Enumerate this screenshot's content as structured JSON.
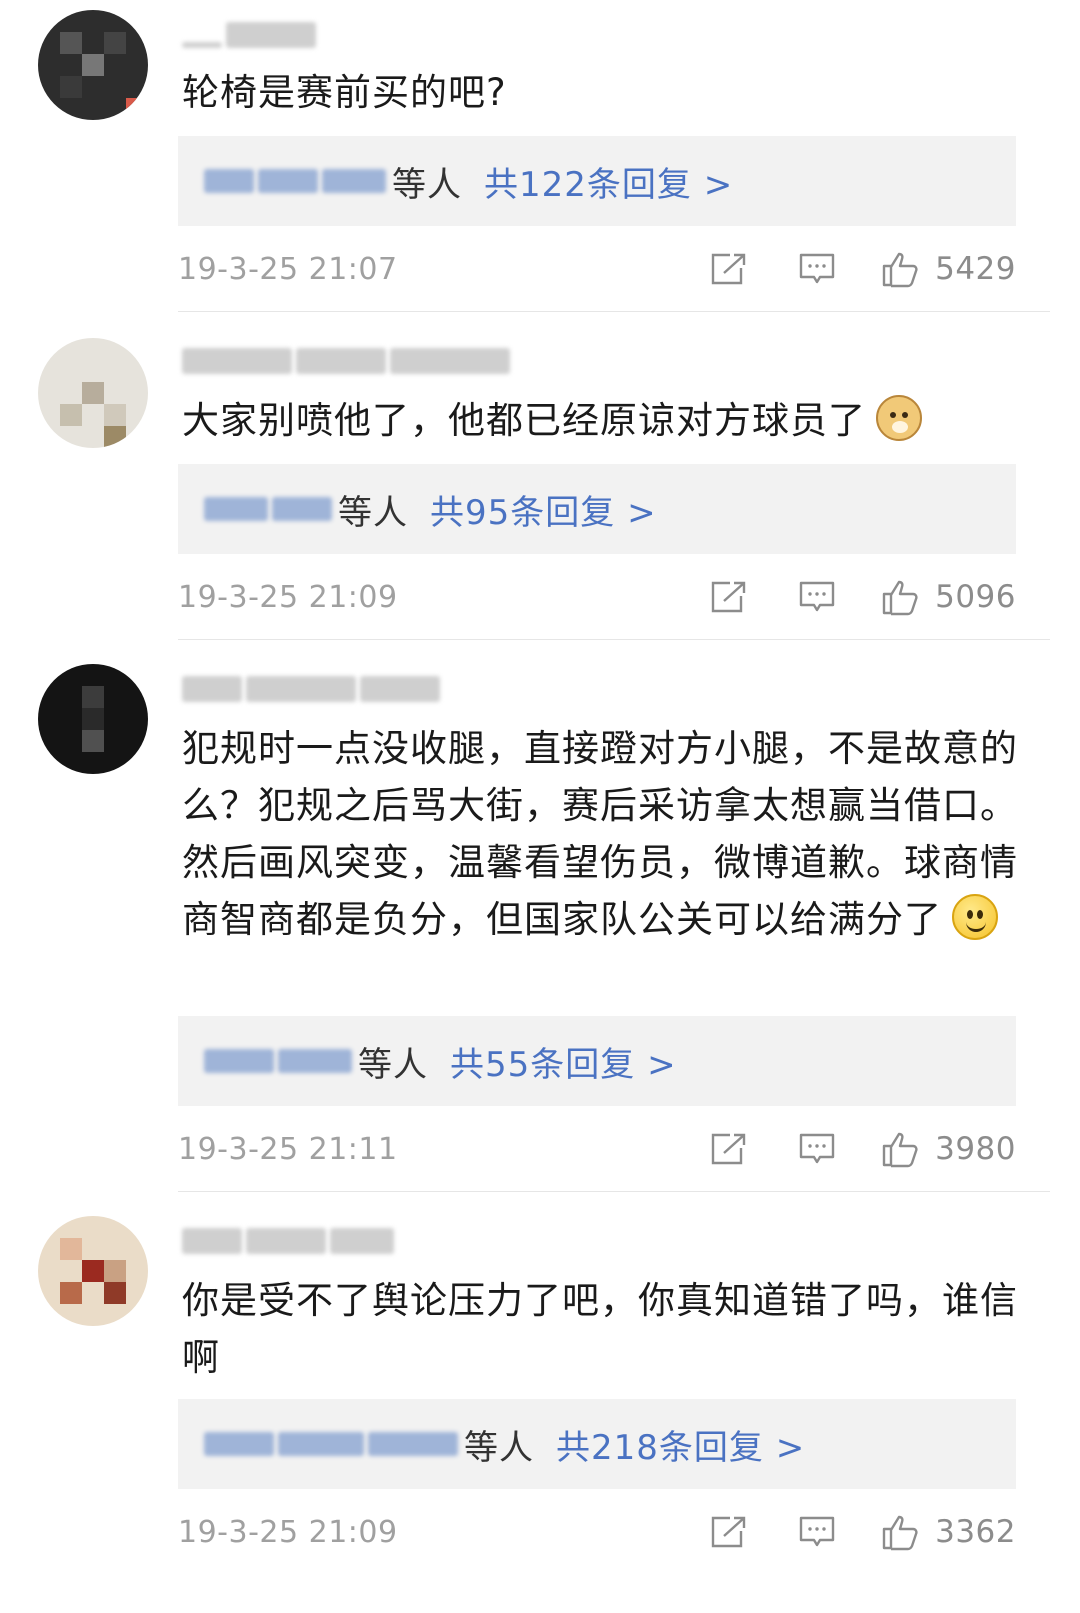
{
  "comments": [
    {
      "text": "轮椅是赛前买的吧?",
      "reply_people": "等人",
      "reply_count": "共122条回复 >",
      "time": "19-3-25 21:07",
      "likes": "5429"
    },
    {
      "text": "大家别喷他了，他都已经原谅对方球员了",
      "emoji": "doge-emoji",
      "reply_people": "等人",
      "reply_count": "共95条回复 >",
      "time": "19-3-25 21:09",
      "likes": "5096"
    },
    {
      "text": "犯规时一点没收腿，直接蹬对方小腿，不是故意的么？犯规之后骂大街，赛后采访拿太想赢当借口。然后画风突变，温馨看望伤员，微博道歉。球商情商智商都是负分，但国家队公关可以给满分了",
      "emoji": "smile-emoji",
      "reply_people": "等人",
      "reply_count": "共55条回复 >",
      "time": "19-3-25 21:11",
      "likes": "3980"
    },
    {
      "text": "你是受不了舆论压力了吧，你真知道错了吗，谁信啊",
      "reply_people": "等人",
      "reply_count": "共218条回复 >",
      "time": "19-3-25 21:09",
      "likes": "3362"
    }
  ],
  "colors": {
    "link": "#4a72c2",
    "timestamp": "#a0a0a0",
    "reply_bg": "#f2f2f2"
  }
}
